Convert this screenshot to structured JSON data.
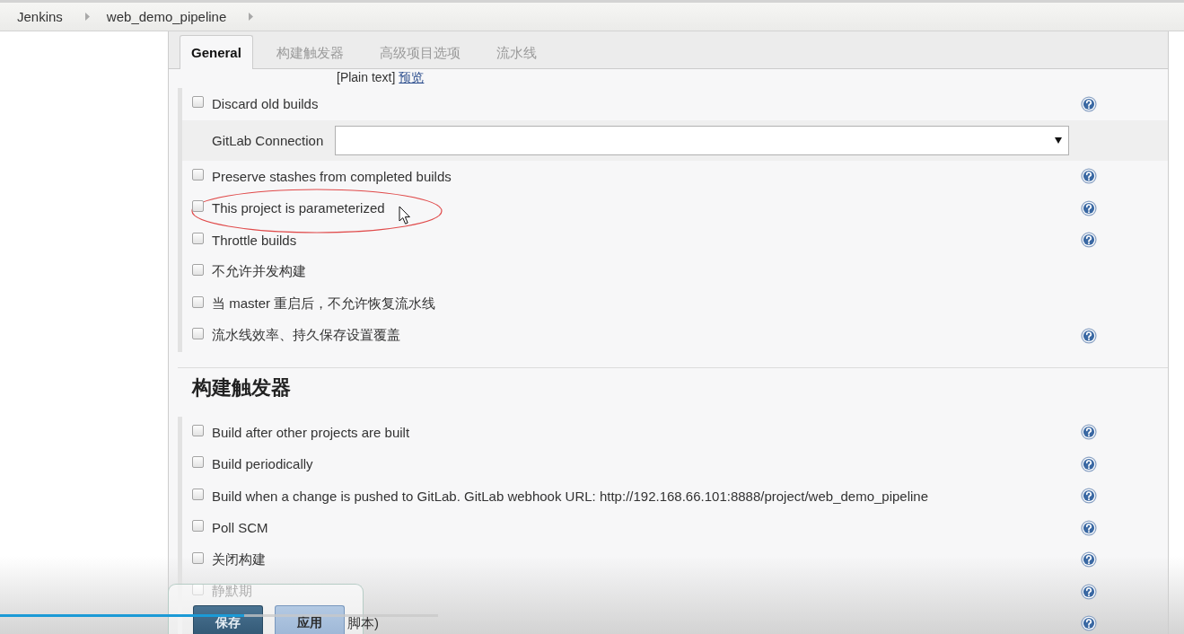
{
  "breadcrumbs": [
    {
      "label": "Jenkins"
    },
    {
      "label": "web_demo_pipeline"
    }
  ],
  "tabs": [
    {
      "label": "General",
      "selected": true
    },
    {
      "label": "构建触发器",
      "selected": false
    },
    {
      "label": "高级项目选项",
      "selected": false
    },
    {
      "label": "流水线",
      "selected": false
    }
  ],
  "description_format": {
    "text": "[Plain text]",
    "link": "预览"
  },
  "general": {
    "options": [
      {
        "kind": "checkbox",
        "label": "Discard old builds",
        "checked": false,
        "help": true,
        "annotated": false
      },
      {
        "kind": "select",
        "label": "GitLab Connection",
        "help": false,
        "annotated": false
      },
      {
        "kind": "checkbox",
        "label": "Preserve stashes from completed builds",
        "checked": false,
        "help": true,
        "annotated": false
      },
      {
        "kind": "checkbox",
        "label": "This project is parameterized",
        "checked": false,
        "help": true,
        "annotated": true
      },
      {
        "kind": "checkbox",
        "label": "Throttle builds",
        "checked": false,
        "help": true,
        "annotated": false
      },
      {
        "kind": "checkbox",
        "label": "不允许并发构建",
        "checked": false,
        "help": false,
        "annotated": false
      },
      {
        "kind": "checkbox",
        "label": "当 master 重启后，不允许恢复流水线",
        "checked": false,
        "help": false,
        "annotated": false
      },
      {
        "kind": "checkbox",
        "label": "流水线效率、持久保存设置覆盖",
        "checked": false,
        "help": true,
        "annotated": false
      }
    ]
  },
  "triggers": {
    "title": "构建触发器",
    "options": [
      {
        "kind": "checkbox",
        "label": "Build after other projects are built",
        "checked": false,
        "help": true
      },
      {
        "kind": "checkbox",
        "label": "Build periodically",
        "checked": false,
        "help": true
      },
      {
        "kind": "checkbox",
        "label": "Build when a change is pushed to GitLab. GitLab webhook URL: http://192.168.66.101:8888/project/web_demo_pipeline",
        "checked": false,
        "help": true
      },
      {
        "kind": "checkbox",
        "label": "Poll SCM",
        "checked": false,
        "help": true
      },
      {
        "kind": "checkbox",
        "label": "关闭构建",
        "checked": false,
        "help": true
      },
      {
        "kind": "checkbox",
        "label": "静默期",
        "checked": false,
        "help": true
      },
      {
        "kind": "partial",
        "label": "脚本)",
        "help": true
      }
    ]
  },
  "actions": [
    {
      "kind": "primary",
      "label": "保存"
    },
    {
      "kind": "secondary",
      "label": "应用"
    }
  ],
  "video_player": {
    "progress": {
      "level": 0.557
    }
  }
}
